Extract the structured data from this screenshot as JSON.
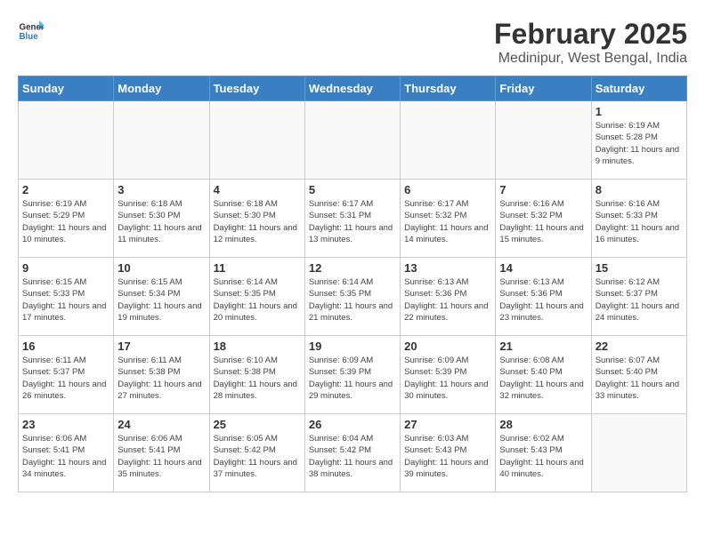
{
  "header": {
    "logo_general": "General",
    "logo_blue": "Blue",
    "title": "February 2025",
    "subtitle": "Medinipur, West Bengal, India"
  },
  "weekdays": [
    "Sunday",
    "Monday",
    "Tuesday",
    "Wednesday",
    "Thursday",
    "Friday",
    "Saturday"
  ],
  "weeks": [
    [
      {
        "day": "",
        "info": ""
      },
      {
        "day": "",
        "info": ""
      },
      {
        "day": "",
        "info": ""
      },
      {
        "day": "",
        "info": ""
      },
      {
        "day": "",
        "info": ""
      },
      {
        "day": "",
        "info": ""
      },
      {
        "day": "1",
        "info": "Sunrise: 6:19 AM\nSunset: 5:28 PM\nDaylight: 11 hours\nand 9 minutes."
      }
    ],
    [
      {
        "day": "2",
        "info": "Sunrise: 6:19 AM\nSunset: 5:29 PM\nDaylight: 11 hours\nand 10 minutes."
      },
      {
        "day": "3",
        "info": "Sunrise: 6:18 AM\nSunset: 5:30 PM\nDaylight: 11 hours\nand 11 minutes."
      },
      {
        "day": "4",
        "info": "Sunrise: 6:18 AM\nSunset: 5:30 PM\nDaylight: 11 hours\nand 12 minutes."
      },
      {
        "day": "5",
        "info": "Sunrise: 6:17 AM\nSunset: 5:31 PM\nDaylight: 11 hours\nand 13 minutes."
      },
      {
        "day": "6",
        "info": "Sunrise: 6:17 AM\nSunset: 5:32 PM\nDaylight: 11 hours\nand 14 minutes."
      },
      {
        "day": "7",
        "info": "Sunrise: 6:16 AM\nSunset: 5:32 PM\nDaylight: 11 hours\nand 15 minutes."
      },
      {
        "day": "8",
        "info": "Sunrise: 6:16 AM\nSunset: 5:33 PM\nDaylight: 11 hours\nand 16 minutes."
      }
    ],
    [
      {
        "day": "9",
        "info": "Sunrise: 6:15 AM\nSunset: 5:33 PM\nDaylight: 11 hours\nand 17 minutes."
      },
      {
        "day": "10",
        "info": "Sunrise: 6:15 AM\nSunset: 5:34 PM\nDaylight: 11 hours\nand 19 minutes."
      },
      {
        "day": "11",
        "info": "Sunrise: 6:14 AM\nSunset: 5:35 PM\nDaylight: 11 hours\nand 20 minutes."
      },
      {
        "day": "12",
        "info": "Sunrise: 6:14 AM\nSunset: 5:35 PM\nDaylight: 11 hours\nand 21 minutes."
      },
      {
        "day": "13",
        "info": "Sunrise: 6:13 AM\nSunset: 5:36 PM\nDaylight: 11 hours\nand 22 minutes."
      },
      {
        "day": "14",
        "info": "Sunrise: 6:13 AM\nSunset: 5:36 PM\nDaylight: 11 hours\nand 23 minutes."
      },
      {
        "day": "15",
        "info": "Sunrise: 6:12 AM\nSunset: 5:37 PM\nDaylight: 11 hours\nand 24 minutes."
      }
    ],
    [
      {
        "day": "16",
        "info": "Sunrise: 6:11 AM\nSunset: 5:37 PM\nDaylight: 11 hours\nand 26 minutes."
      },
      {
        "day": "17",
        "info": "Sunrise: 6:11 AM\nSunset: 5:38 PM\nDaylight: 11 hours\nand 27 minutes."
      },
      {
        "day": "18",
        "info": "Sunrise: 6:10 AM\nSunset: 5:38 PM\nDaylight: 11 hours\nand 28 minutes."
      },
      {
        "day": "19",
        "info": "Sunrise: 6:09 AM\nSunset: 5:39 PM\nDaylight: 11 hours\nand 29 minutes."
      },
      {
        "day": "20",
        "info": "Sunrise: 6:09 AM\nSunset: 5:39 PM\nDaylight: 11 hours\nand 30 minutes."
      },
      {
        "day": "21",
        "info": "Sunrise: 6:08 AM\nSunset: 5:40 PM\nDaylight: 11 hours\nand 32 minutes."
      },
      {
        "day": "22",
        "info": "Sunrise: 6:07 AM\nSunset: 5:40 PM\nDaylight: 11 hours\nand 33 minutes."
      }
    ],
    [
      {
        "day": "23",
        "info": "Sunrise: 6:06 AM\nSunset: 5:41 PM\nDaylight: 11 hours\nand 34 minutes."
      },
      {
        "day": "24",
        "info": "Sunrise: 6:06 AM\nSunset: 5:41 PM\nDaylight: 11 hours\nand 35 minutes."
      },
      {
        "day": "25",
        "info": "Sunrise: 6:05 AM\nSunset: 5:42 PM\nDaylight: 11 hours\nand 37 minutes."
      },
      {
        "day": "26",
        "info": "Sunrise: 6:04 AM\nSunset: 5:42 PM\nDaylight: 11 hours\nand 38 minutes."
      },
      {
        "day": "27",
        "info": "Sunrise: 6:03 AM\nSunset: 5:43 PM\nDaylight: 11 hours\nand 39 minutes."
      },
      {
        "day": "28",
        "info": "Sunrise: 6:02 AM\nSunset: 5:43 PM\nDaylight: 11 hours\nand 40 minutes."
      },
      {
        "day": "",
        "info": ""
      }
    ]
  ]
}
